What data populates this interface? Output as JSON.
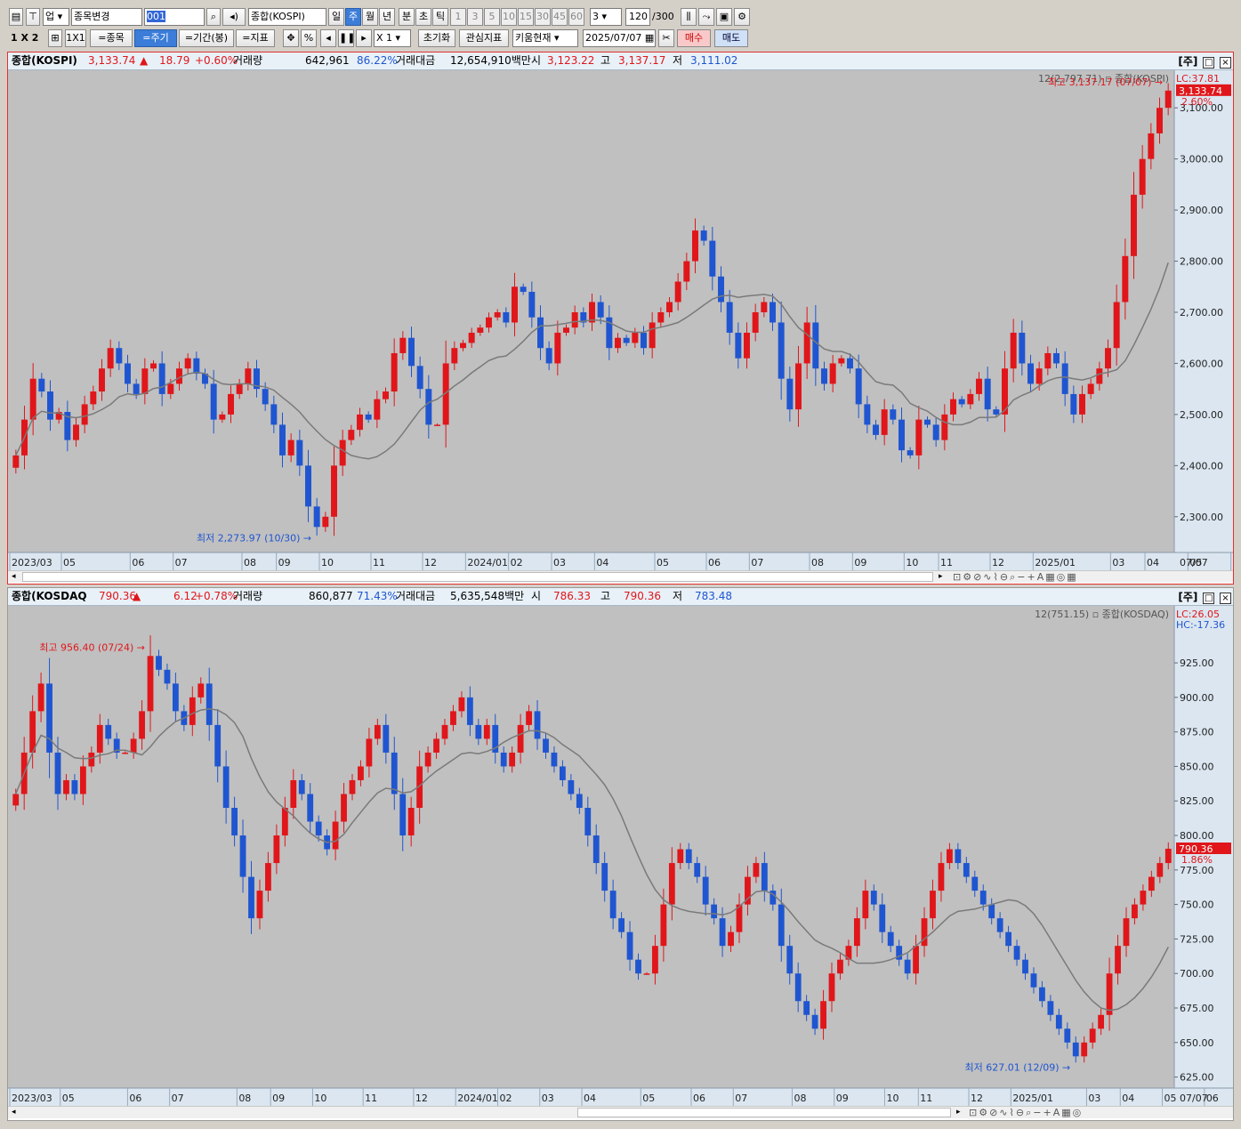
{
  "toolbar1": {
    "market": "업",
    "change_stock": "종목변경",
    "code": "001",
    "index_name": "종합(KOSPI)",
    "periods": [
      "일",
      "주",
      "월",
      "년",
      "분",
      "초",
      "틱"
    ],
    "active_period": "주",
    "intervals": [
      "1",
      "3",
      "5",
      "10",
      "15",
      "30",
      "45",
      "60"
    ],
    "interval_value": "3",
    "count": "120",
    "count_max": "/300"
  },
  "toolbar2": {
    "layout_label": "1 X 2",
    "layout_1x1": "1X1",
    "stock_btn": "=종목",
    "period_btn": "=주기",
    "range_btn": "=기간(봉)",
    "indicator_btn": "=지표",
    "percent": "%",
    "multiplier": "X 1",
    "reset": "초기화",
    "watch_indicator": "관심지표",
    "kiwoom_current": "키움현재",
    "date": "2025/07/07",
    "buy": "매수",
    "sell": "매도"
  },
  "colors": {
    "up": "#e0161a",
    "down": "#1f55d0",
    "ma": "#7a7a7a",
    "chart_bg": "#c0c0c0",
    "axis_bg": "#dbe6f0"
  },
  "kospi_info": {
    "name": "종합(KOSPI)",
    "price": "3,133.74",
    "arrow": "▲",
    "change": "18.79",
    "pct": "+0.60%",
    "vol_label": "거래량",
    "volume": "642,961",
    "vol_ratio": "86.22%",
    "amt_label": "거래대금",
    "amount": "12,654,910백만",
    "open_label": "시",
    "open": "3,123.22",
    "high_label": "고",
    "high": "3,137.17",
    "low_label": "저",
    "low": "3,111.02",
    "period_tag": "[주]"
  },
  "kosdaq_info": {
    "name": "종합(KOSDAQ",
    "price": "790.36",
    "arrow": "▲",
    "change": "6.12",
    "pct": "+0.78%",
    "vol_label": "거래량",
    "volume": "860,877",
    "vol_ratio": "71.43%",
    "amt_label": "거래대금",
    "amount": "5,635,548백만",
    "open_label": "시",
    "open": "786.33",
    "high_label": "고",
    "high": "790.36",
    "low_label": "저",
    "low": "783.48",
    "period_tag": "[주]"
  },
  "chart_data": [
    {
      "type": "candlestick",
      "title": "종합(KOSPI)",
      "legend": "12(2,797.71) ▫ 종합(KOSPI)",
      "ylim": [
        2230,
        3170
      ],
      "yticks": [
        2300,
        2400,
        2500,
        2600,
        2700,
        2800,
        2900,
        3000,
        3100
      ],
      "ytick_labels": [
        "2,300.00",
        "2,400.00",
        "2,500.00",
        "2,600.00",
        "2,700.00",
        "2,800.00",
        "2,900.00",
        "3,000.00",
        "3,100.00"
      ],
      "x_labels": [
        "2023/03",
        "05",
        "06",
        "07",
        "08",
        "09",
        "10",
        "11",
        "12",
        "2024/01",
        "02",
        "03",
        "04",
        "05",
        "06",
        "07",
        "08",
        "09",
        "10",
        "11",
        "12",
        "2025/01",
        "03",
        "04",
        "05",
        "06",
        "07"
      ],
      "x_label_index": [
        0,
        6,
        14,
        19,
        27,
        31,
        36,
        42,
        48,
        53,
        58,
        63,
        68,
        75,
        81,
        86,
        93,
        98,
        104,
        108,
        114,
        119,
        128,
        132,
        137,
        142,
        149
      ],
      "x_last_label": "07/07",
      "last_price_label": "3,133.74",
      "last_pct_label": "2.60%",
      "LC": "LC:37.81",
      "max_label": "최고 3,137.17 (07/07)",
      "min_label": "최저 2,273.97 (10/30)",
      "closes": [
        2420,
        2490,
        2570,
        2545,
        2490,
        2505,
        2450,
        2480,
        2520,
        2545,
        2590,
        2630,
        2600,
        2560,
        2540,
        2590,
        2600,
        2540,
        2560,
        2590,
        2610,
        2580,
        2560,
        2490,
        2500,
        2540,
        2560,
        2590,
        2550,
        2520,
        2480,
        2420,
        2450,
        2400,
        2320,
        2280,
        2300,
        2400,
        2450,
        2470,
        2500,
        2490,
        2530,
        2545,
        2620,
        2650,
        2595,
        2550,
        2480,
        2480,
        2600,
        2630,
        2640,
        2660,
        2670,
        2690,
        2700,
        2680,
        2750,
        2740,
        2690,
        2630,
        2600,
        2660,
        2670,
        2700,
        2680,
        2720,
        2690,
        2630,
        2650,
        2640,
        2660,
        2630,
        2680,
        2700,
        2720,
        2760,
        2800,
        2860,
        2840,
        2770,
        2720,
        2660,
        2610,
        2660,
        2700,
        2720,
        2680,
        2570,
        2510,
        2600,
        2680,
        2590,
        2560,
        2600,
        2610,
        2590,
        2520,
        2480,
        2460,
        2510,
        2490,
        2430,
        2420,
        2490,
        2480,
        2450,
        2500,
        2530,
        2520,
        2540,
        2570,
        2510,
        2500,
        2590,
        2660,
        2600,
        2560,
        2590,
        2620,
        2600,
        2540,
        2500,
        2540,
        2560,
        2590,
        2630,
        2720,
        2810,
        2930,
        3000,
        3050,
        3100,
        3133.74
      ]
    },
    {
      "type": "candlestick",
      "title": "종합(KOSDAQ)",
      "legend": "12(751.15) ▫ 종합(KOSDAQ)",
      "ylim": [
        617,
        965
      ],
      "yticks": [
        625,
        650,
        675,
        700,
        725,
        750,
        775,
        800,
        825,
        850,
        875,
        900,
        925
      ],
      "ytick_labels": [
        "625.00",
        "650.00",
        "675.00",
        "700.00",
        "725.00",
        "750.00",
        "775.00",
        "800.00",
        "825.00",
        "850.00",
        "875.00",
        "900.00",
        "925.00"
      ],
      "x_labels": [
        "2023/03",
        "05",
        "06",
        "07",
        "08",
        "09",
        "10",
        "11",
        "12",
        "2024/01",
        "02",
        "03",
        "04",
        "05",
        "06",
        "07",
        "08",
        "09",
        "10",
        "11",
        "12",
        "2025/01",
        "03",
        "04",
        "05",
        "06",
        "07"
      ],
      "x_label_index": [
        0,
        6,
        14,
        19,
        27,
        31,
        36,
        42,
        48,
        53,
        58,
        63,
        68,
        75,
        81,
        86,
        93,
        98,
        104,
        108,
        114,
        119,
        128,
        132,
        137,
        142,
        149
      ],
      "x_last_label": "07/07",
      "last_price_label": "790.36",
      "last_pct_label": "1.86%",
      "LC": "LC:26.05",
      "HC": "HC:-17.36",
      "max_label": "최고 956.40 (07/24)",
      "min_label": "최저 627.01 (12/09)",
      "closes": [
        830,
        860,
        890,
        910,
        860,
        830,
        840,
        830,
        850,
        860,
        880,
        870,
        860,
        860,
        870,
        890,
        930,
        920,
        910,
        890,
        880,
        900,
        910,
        880,
        850,
        820,
        800,
        770,
        740,
        760,
        780,
        800,
        820,
        840,
        830,
        810,
        800,
        790,
        810,
        830,
        840,
        850,
        870,
        880,
        860,
        830,
        800,
        820,
        850,
        860,
        870,
        880,
        890,
        900,
        880,
        870,
        880,
        860,
        850,
        860,
        880,
        890,
        870,
        860,
        850,
        840,
        830,
        820,
        800,
        780,
        760,
        740,
        730,
        710,
        700,
        700,
        720,
        750,
        780,
        790,
        780,
        770,
        750,
        740,
        720,
        730,
        750,
        770,
        780,
        760,
        750,
        720,
        700,
        680,
        670,
        660,
        680,
        700,
        710,
        720,
        740,
        760,
        750,
        730,
        720,
        710,
        700,
        720,
        740,
        760,
        780,
        790,
        780,
        770,
        760,
        750,
        740,
        730,
        720,
        710,
        700,
        690,
        680,
        670,
        660,
        650,
        640,
        650,
        660,
        670,
        700,
        720,
        740,
        750,
        760,
        770,
        780,
        790.36
      ]
    }
  ]
}
